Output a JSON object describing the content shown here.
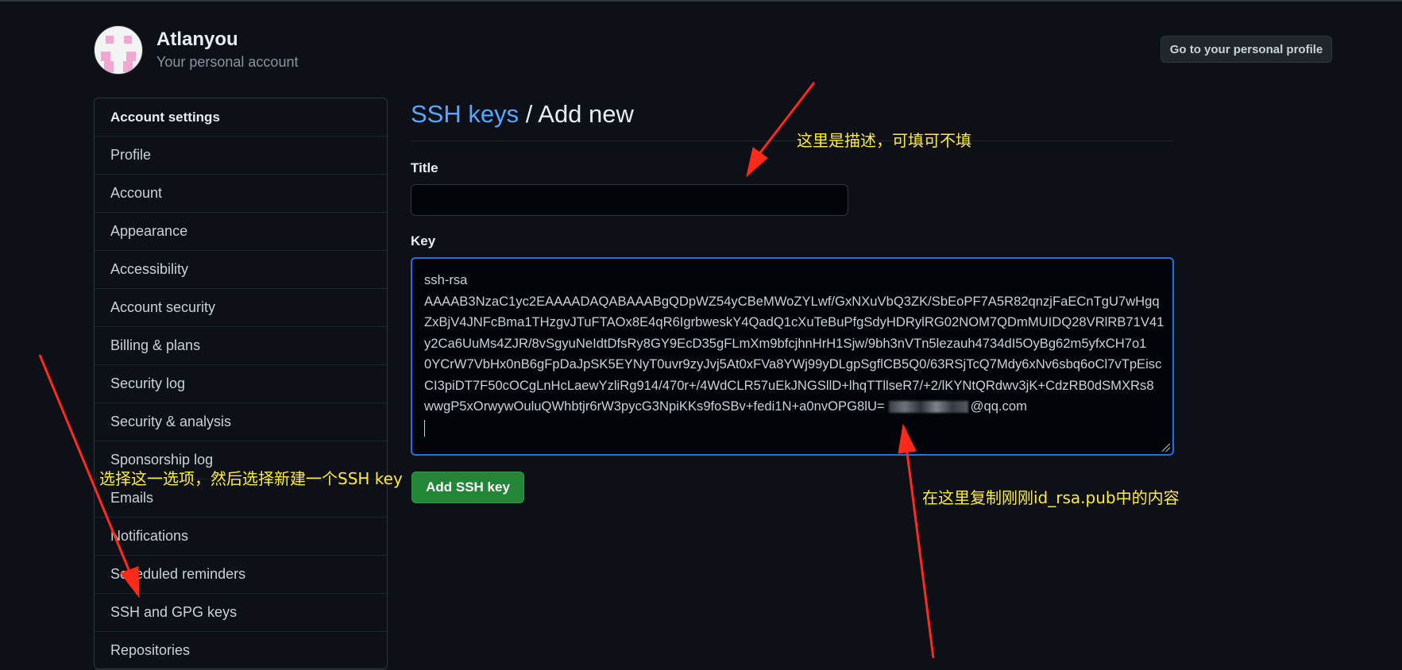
{
  "header": {
    "account_name": "Atlanyou",
    "account_subtitle": "Your personal account",
    "profile_button": "Go to your personal profile"
  },
  "sidebar": {
    "heading": "Account settings",
    "items": [
      {
        "label": "Profile"
      },
      {
        "label": "Account"
      },
      {
        "label": "Appearance"
      },
      {
        "label": "Accessibility"
      },
      {
        "label": "Account security"
      },
      {
        "label": "Billing & plans"
      },
      {
        "label": "Security log"
      },
      {
        "label": "Security & analysis"
      },
      {
        "label": "Sponsorship log"
      },
      {
        "label": "Emails"
      },
      {
        "label": "Notifications"
      },
      {
        "label": "Scheduled reminders"
      },
      {
        "label": "SSH and GPG keys"
      },
      {
        "label": "Repositories"
      }
    ]
  },
  "main": {
    "breadcrumb_link": "SSH keys",
    "breadcrumb_separator": "/",
    "breadcrumb_current": "Add new",
    "title_label": "Title",
    "title_value": "",
    "key_label": "Key",
    "key_lines": [
      "ssh-rsa",
      "AAAAB3NzaC1yc2EAAAADAQABAAABgQDpWZ54yCBeMWoZYLwf/GxNXuVbQ3ZK/SbEoPF7A5R82qnzjFaECnTgU7wHgq",
      "ZxBjV4JNFcBma1THzgvJTuFTAOx8E4qR6IgrbweskY4QadQ1cXuTeBuPfgSdyHDRylRG02NOM7QDmMUIDQ28VRlRB71V41",
      "y2Ca6UuMs4ZJR/8vSgyuNeIdtDfsRy8GY9EcD35gFLmXm9bfcjhnHrH1Sjw/9bh3nVTn5lezauh4734dI5OyBg62m5yfxCH7o1",
      "0YCrW7VbHx0nB6gFpDaJpSK5EYNyT0uvr9zyJvj5At0xFVa8YWj99yDLgpSgflCB5Q0/63RSjTcQ7Mdy6xNv6sbq6oCl7vTpEisc",
      "CI3piDT7F50cOCgLnHcLaewYzliRg914/470r+/4WdCLR57uEkJNGSllD+lhqTTllseR7/+2/lKYNtQRdwv3jK+CdzRB0dSMXRs8"
    ],
    "key_last_line_prefix": "wwgP5xOrwywOuluQWhbtjr6rW3pycG3NpiKKs9foSBv+fedi1N+a0nvOPG8lU=",
    "key_last_line_suffix": "@qq.com",
    "submit_button": "Add SSH key"
  },
  "annotations": {
    "title_note": "这里是描述，可填可不填",
    "sidebar_note": "选择这一选项，然后选择新建一个SSH key",
    "key_note": "在这里复制刚刚id_rsa.pub中的内容",
    "color": "#ffeb3b",
    "arrow_color": "#ff2a1a"
  }
}
